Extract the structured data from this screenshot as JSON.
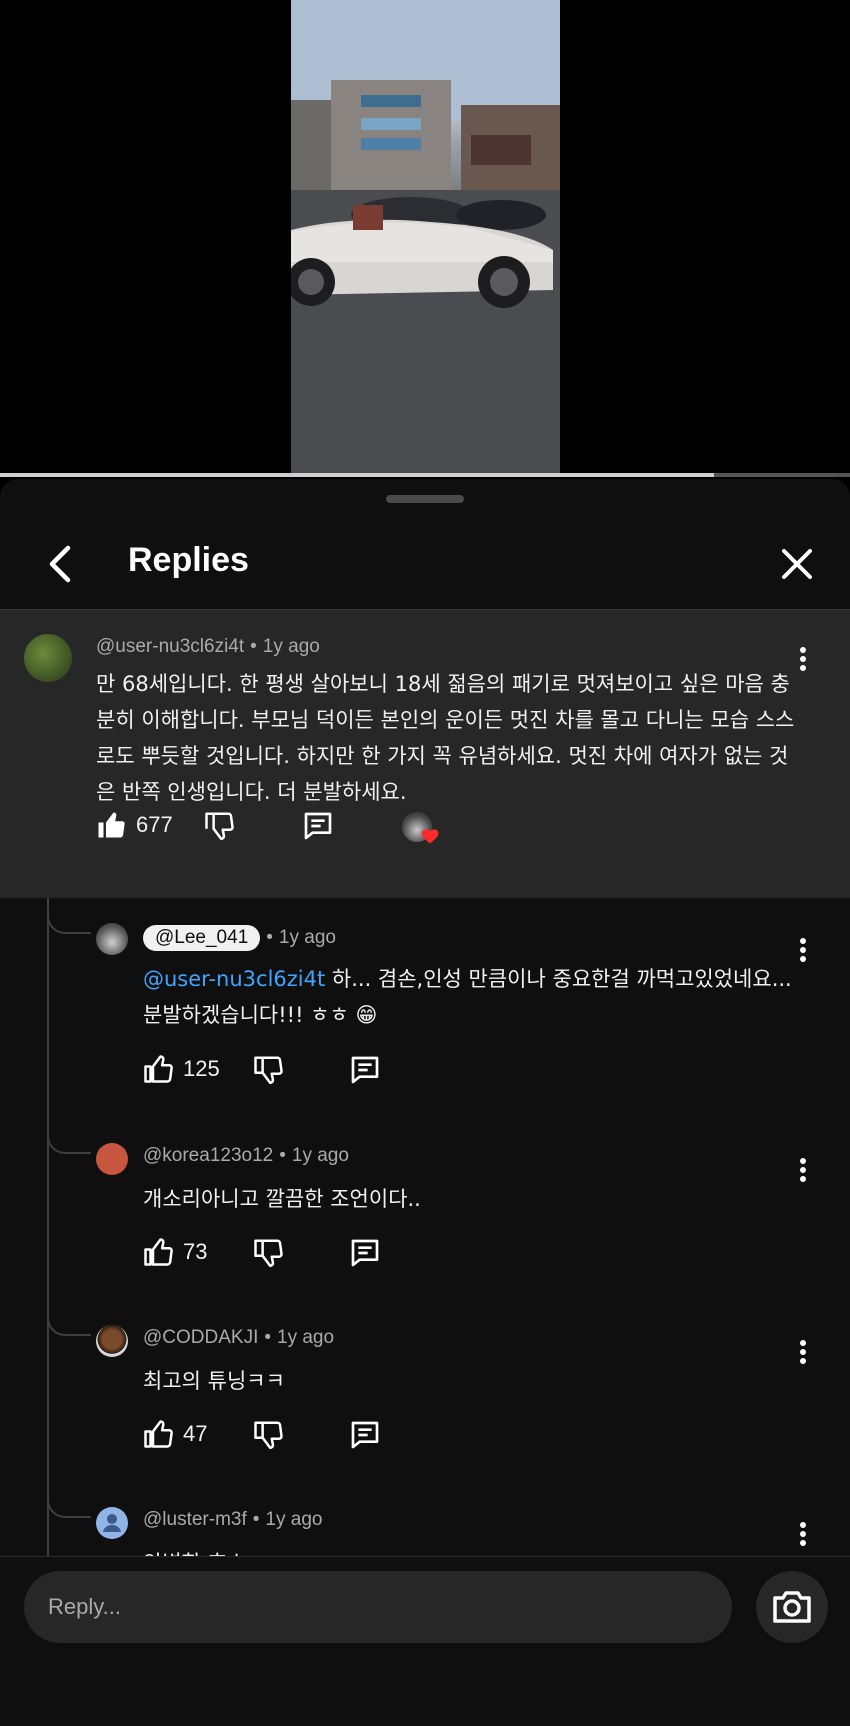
{
  "sheet": {
    "title": "Replies"
  },
  "parent_comment": {
    "author": "@user-nu3cl6zi4t",
    "time": "1y ago",
    "text": "만 68세입니다. 한 평생 살아보니 18세 젊음의 패기로 멋져보이고 싶은 마음 충분히 이해합니다. 부모님 덕이든 본인의 운이든 멋진 차를 몰고 다니는 모습 스스로도 뿌듯할 것입니다. 하지만 한 가지 꼭 유념하세요. 멋진 차에 여자가 없는 것은 반쪽 인생입니다. 더 분발하세요.",
    "likes": "677"
  },
  "replies": [
    {
      "author": "@Lee_041",
      "time": "1y ago",
      "mention": "@user-nu3cl6zi4t",
      "text": " 하... 겸손,인성 만큼이나 중요한걸 까먹고있었네요... 분발하겠습니다!!! ㅎㅎ 😁",
      "likes": "125"
    },
    {
      "author": "@korea123o12",
      "time": "1y ago",
      "text": "개소리아니고 깔끔한 조언이다..",
      "likes": "73"
    },
    {
      "author": "@CODDAKJI",
      "time": "1y ago",
      "text": "최고의 튜닝ㅋㅋ",
      "likes": "47"
    },
    {
      "author": "@luster-m3f",
      "time": "1y ago",
      "text": "안병한 호소"
    }
  ],
  "reply_bar": {
    "placeholder": "Reply..."
  },
  "video": {
    "progress": 0.84
  },
  "colors": {
    "background": "#0f0f0f",
    "parent_highlight": "#272727",
    "mention": "#3ea6ff",
    "secondary_text": "#aaaaaa"
  },
  "icons": [
    "back-arrow-icon",
    "close-icon",
    "like-icon",
    "dislike-icon",
    "reply-icon",
    "more-vert-icon",
    "heart-icon",
    "camera-icon"
  ]
}
